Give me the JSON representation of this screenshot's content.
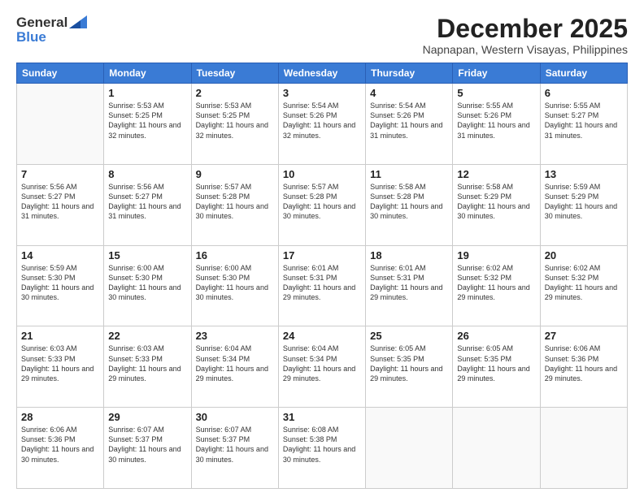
{
  "header": {
    "logo_general": "General",
    "logo_blue": "Blue",
    "month_title": "December 2025",
    "location": "Napnapan, Western Visayas, Philippines"
  },
  "weekdays": [
    "Sunday",
    "Monday",
    "Tuesday",
    "Wednesday",
    "Thursday",
    "Friday",
    "Saturday"
  ],
  "weeks": [
    [
      {
        "day": "",
        "sunrise": "",
        "sunset": "",
        "daylight": ""
      },
      {
        "day": "1",
        "sunrise": "5:53 AM",
        "sunset": "5:25 PM",
        "daylight": "11 hours and 32 minutes."
      },
      {
        "day": "2",
        "sunrise": "5:53 AM",
        "sunset": "5:25 PM",
        "daylight": "11 hours and 32 minutes."
      },
      {
        "day": "3",
        "sunrise": "5:54 AM",
        "sunset": "5:26 PM",
        "daylight": "11 hours and 32 minutes."
      },
      {
        "day": "4",
        "sunrise": "5:54 AM",
        "sunset": "5:26 PM",
        "daylight": "11 hours and 31 minutes."
      },
      {
        "day": "5",
        "sunrise": "5:55 AM",
        "sunset": "5:26 PM",
        "daylight": "11 hours and 31 minutes."
      },
      {
        "day": "6",
        "sunrise": "5:55 AM",
        "sunset": "5:27 PM",
        "daylight": "11 hours and 31 minutes."
      }
    ],
    [
      {
        "day": "7",
        "sunrise": "5:56 AM",
        "sunset": "5:27 PM",
        "daylight": "11 hours and 31 minutes."
      },
      {
        "day": "8",
        "sunrise": "5:56 AM",
        "sunset": "5:27 PM",
        "daylight": "11 hours and 31 minutes."
      },
      {
        "day": "9",
        "sunrise": "5:57 AM",
        "sunset": "5:28 PM",
        "daylight": "11 hours and 30 minutes."
      },
      {
        "day": "10",
        "sunrise": "5:57 AM",
        "sunset": "5:28 PM",
        "daylight": "11 hours and 30 minutes."
      },
      {
        "day": "11",
        "sunrise": "5:58 AM",
        "sunset": "5:28 PM",
        "daylight": "11 hours and 30 minutes."
      },
      {
        "day": "12",
        "sunrise": "5:58 AM",
        "sunset": "5:29 PM",
        "daylight": "11 hours and 30 minutes."
      },
      {
        "day": "13",
        "sunrise": "5:59 AM",
        "sunset": "5:29 PM",
        "daylight": "11 hours and 30 minutes."
      }
    ],
    [
      {
        "day": "14",
        "sunrise": "5:59 AM",
        "sunset": "5:30 PM",
        "daylight": "11 hours and 30 minutes."
      },
      {
        "day": "15",
        "sunrise": "6:00 AM",
        "sunset": "5:30 PM",
        "daylight": "11 hours and 30 minutes."
      },
      {
        "day": "16",
        "sunrise": "6:00 AM",
        "sunset": "5:30 PM",
        "daylight": "11 hours and 30 minutes."
      },
      {
        "day": "17",
        "sunrise": "6:01 AM",
        "sunset": "5:31 PM",
        "daylight": "11 hours and 29 minutes."
      },
      {
        "day": "18",
        "sunrise": "6:01 AM",
        "sunset": "5:31 PM",
        "daylight": "11 hours and 29 minutes."
      },
      {
        "day": "19",
        "sunrise": "6:02 AM",
        "sunset": "5:32 PM",
        "daylight": "11 hours and 29 minutes."
      },
      {
        "day": "20",
        "sunrise": "6:02 AM",
        "sunset": "5:32 PM",
        "daylight": "11 hours and 29 minutes."
      }
    ],
    [
      {
        "day": "21",
        "sunrise": "6:03 AM",
        "sunset": "5:33 PM",
        "daylight": "11 hours and 29 minutes."
      },
      {
        "day": "22",
        "sunrise": "6:03 AM",
        "sunset": "5:33 PM",
        "daylight": "11 hours and 29 minutes."
      },
      {
        "day": "23",
        "sunrise": "6:04 AM",
        "sunset": "5:34 PM",
        "daylight": "11 hours and 29 minutes."
      },
      {
        "day": "24",
        "sunrise": "6:04 AM",
        "sunset": "5:34 PM",
        "daylight": "11 hours and 29 minutes."
      },
      {
        "day": "25",
        "sunrise": "6:05 AM",
        "sunset": "5:35 PM",
        "daylight": "11 hours and 29 minutes."
      },
      {
        "day": "26",
        "sunrise": "6:05 AM",
        "sunset": "5:35 PM",
        "daylight": "11 hours and 29 minutes."
      },
      {
        "day": "27",
        "sunrise": "6:06 AM",
        "sunset": "5:36 PM",
        "daylight": "11 hours and 29 minutes."
      }
    ],
    [
      {
        "day": "28",
        "sunrise": "6:06 AM",
        "sunset": "5:36 PM",
        "daylight": "11 hours and 30 minutes."
      },
      {
        "day": "29",
        "sunrise": "6:07 AM",
        "sunset": "5:37 PM",
        "daylight": "11 hours and 30 minutes."
      },
      {
        "day": "30",
        "sunrise": "6:07 AM",
        "sunset": "5:37 PM",
        "daylight": "11 hours and 30 minutes."
      },
      {
        "day": "31",
        "sunrise": "6:08 AM",
        "sunset": "5:38 PM",
        "daylight": "11 hours and 30 minutes."
      },
      {
        "day": "",
        "sunrise": "",
        "sunset": "",
        "daylight": ""
      },
      {
        "day": "",
        "sunrise": "",
        "sunset": "",
        "daylight": ""
      },
      {
        "day": "",
        "sunrise": "",
        "sunset": "",
        "daylight": ""
      }
    ]
  ]
}
